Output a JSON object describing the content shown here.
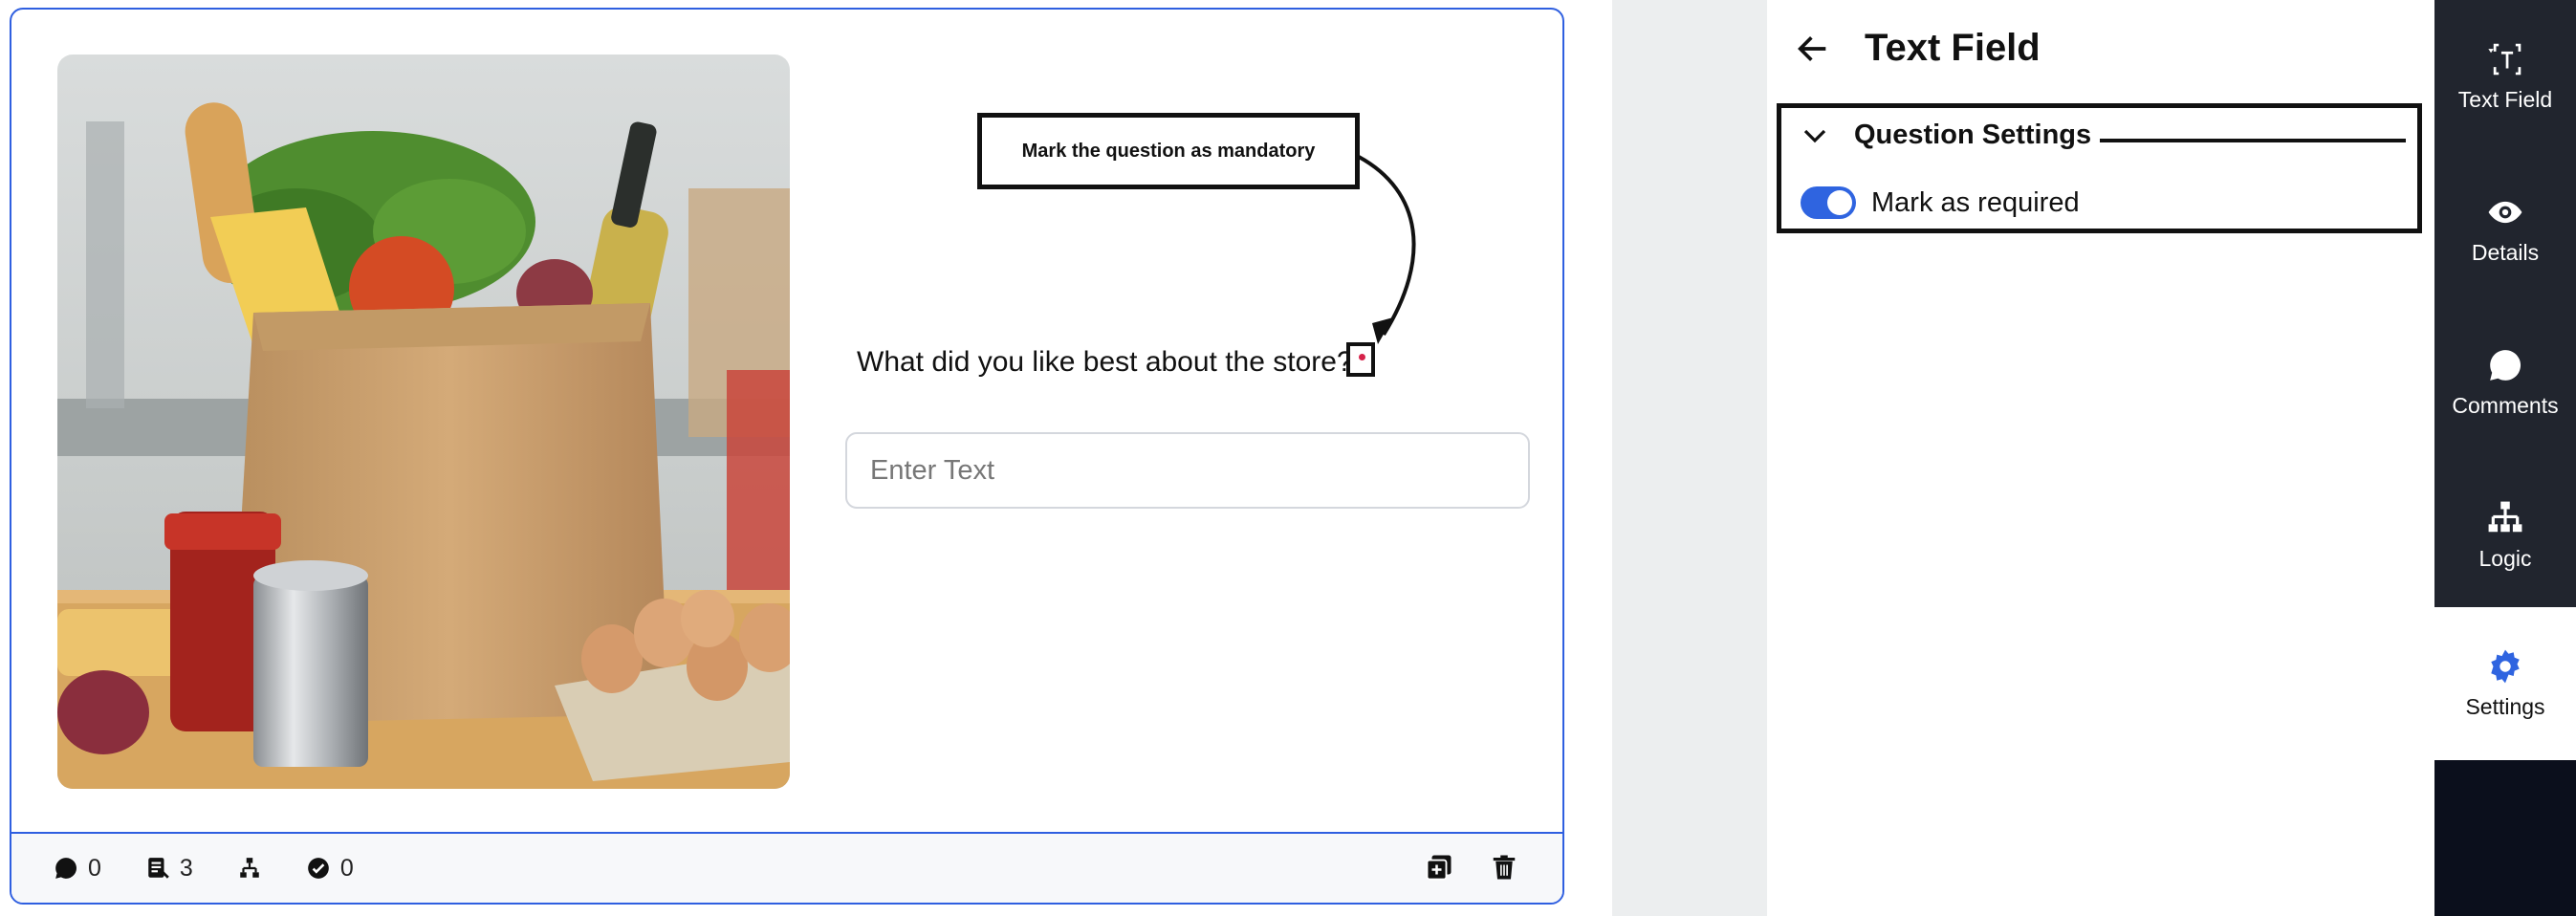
{
  "question": {
    "text": "What did you like best about the store?",
    "input_placeholder": "Enter Text"
  },
  "annotations": {
    "mandatory_callout": "Mark the question as mandatory"
  },
  "footer": {
    "comments_count": "0",
    "responses_count": "3",
    "approvals_count": "0"
  },
  "panel": {
    "title": "Text Field",
    "section_title": "Question Settings",
    "required_toggle_label": "Mark as required",
    "required_toggle_on": true
  },
  "sidenav": {
    "items": [
      {
        "label": "Text Field",
        "icon": "text-field-icon"
      },
      {
        "label": "Details",
        "icon": "eye-icon"
      },
      {
        "label": "Comments",
        "icon": "comment-icon"
      },
      {
        "label": "Logic",
        "icon": "logic-tree-icon"
      },
      {
        "label": "Settings",
        "icon": "gear-icon"
      }
    ]
  },
  "colors": {
    "accent": "#2f64e0",
    "nav_bg": "#0b0f1c",
    "required_marker": "#d6224a"
  }
}
